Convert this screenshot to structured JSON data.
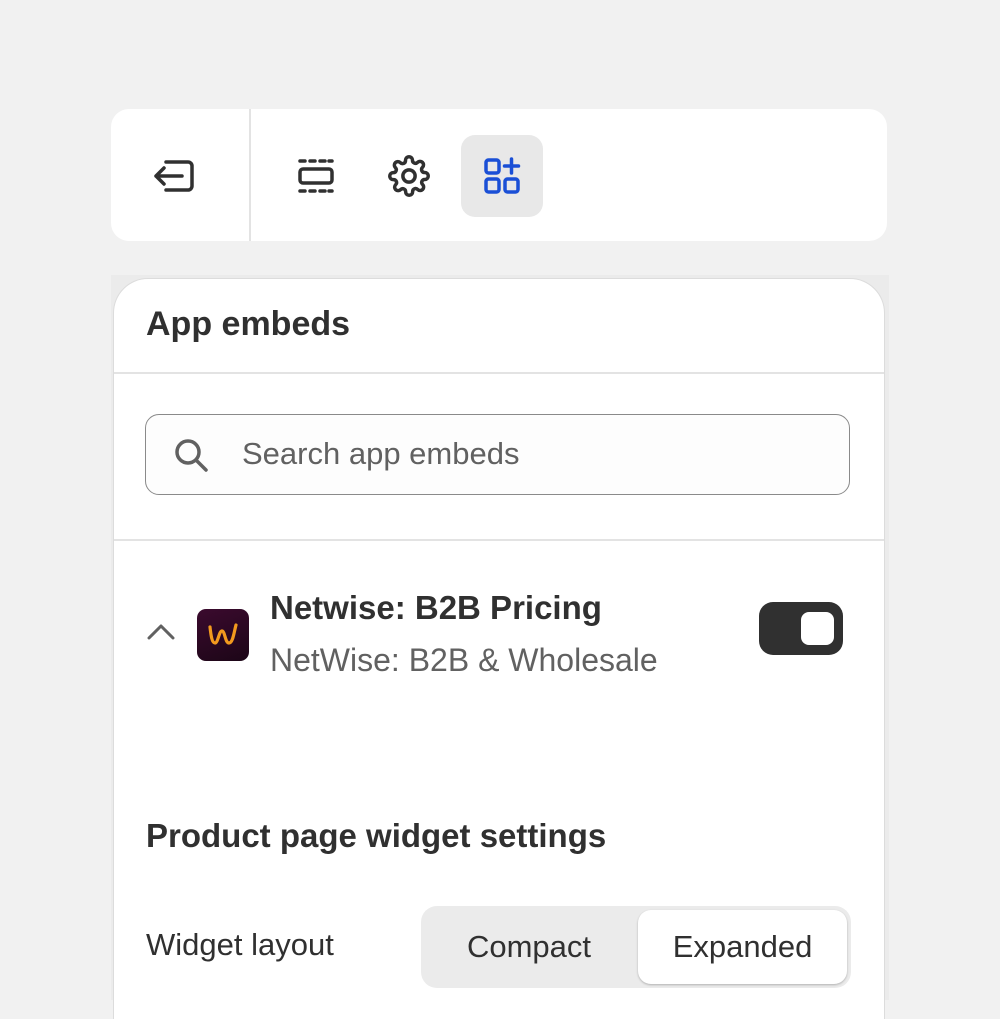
{
  "toolbar": {
    "exit_icon": "exit-icon",
    "sections_icon": "sections-icon",
    "settings_icon": "gear-icon",
    "app_embeds_icon": "apps-plus-icon",
    "active_tab": "app-embeds",
    "accent": "#1a4fd6"
  },
  "panel": {
    "title": "App embeds",
    "search": {
      "placeholder": "Search app embeds",
      "value": ""
    },
    "embed": {
      "name": "Netwise: B2B Pricing",
      "subtitle": "NetWise: B2B & Wholesale",
      "logo_letter": "w",
      "logo_color": "#f29a1e",
      "enabled": true,
      "expanded": true
    },
    "settings": {
      "section_title": "Product page widget settings",
      "layout_label": "Widget layout",
      "layout_options": [
        "Compact",
        "Expanded"
      ],
      "layout_selected": "Expanded"
    }
  }
}
